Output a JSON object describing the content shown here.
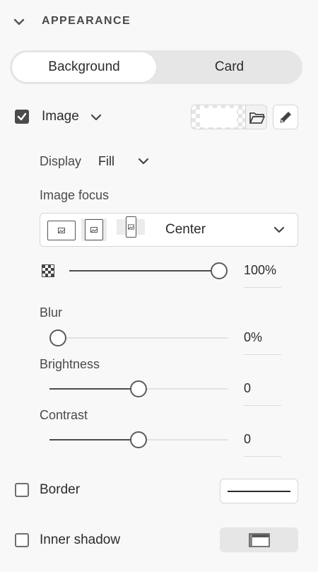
{
  "section": {
    "title": "APPEARANCE",
    "icon": "chevron-down-icon"
  },
  "tabs": [
    {
      "label": "Background",
      "active": true
    },
    {
      "label": "Card",
      "active": false
    }
  ],
  "image": {
    "label": "Image",
    "checked": true,
    "icons": [
      "folder-icon",
      "pencil-icon"
    ]
  },
  "display": {
    "label": "Display",
    "value": "Fill"
  },
  "focus": {
    "label": "Image focus",
    "value": "Center"
  },
  "opacity": {
    "icon": "transparency-icon",
    "value": "100%",
    "level": 1.0
  },
  "blur": {
    "label": "Blur",
    "value": "0%",
    "level": 0.0
  },
  "brightness": {
    "label": "Brightness",
    "value": "0",
    "level": 0.5
  },
  "contrast": {
    "label": "Contrast",
    "value": "0",
    "level": 0.5
  },
  "border": {
    "label": "Border",
    "checked": false
  },
  "inner_shadow": {
    "label": "Inner shadow",
    "checked": false
  },
  "colors": {
    "accent": "#4b4b4b",
    "track": "#e2e2e2",
    "panel": "#f8f8f8"
  }
}
